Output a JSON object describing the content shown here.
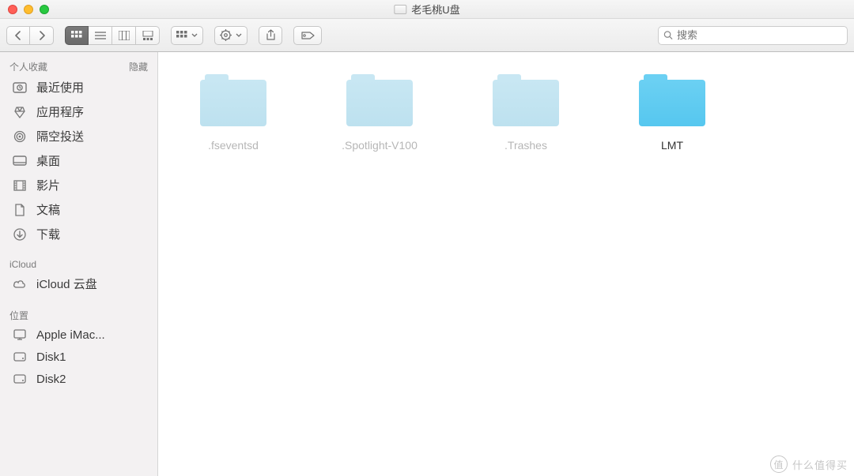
{
  "window": {
    "title": "老毛桃U盘"
  },
  "toolbar": {
    "search_placeholder": "搜索"
  },
  "sidebar": {
    "sections": [
      {
        "title": "个人收藏",
        "hide_label": "隐藏",
        "items": [
          {
            "icon": "clock",
            "label": "最近使用"
          },
          {
            "icon": "apps",
            "label": "应用程序"
          },
          {
            "icon": "airdrop",
            "label": "隔空投送"
          },
          {
            "icon": "desktop",
            "label": "桌面"
          },
          {
            "icon": "movies",
            "label": "影片"
          },
          {
            "icon": "docs",
            "label": "文稿"
          },
          {
            "icon": "downloads",
            "label": "下载"
          }
        ]
      },
      {
        "title": "iCloud",
        "hide_label": "",
        "items": [
          {
            "icon": "cloud",
            "label": "iCloud 云盘"
          }
        ]
      },
      {
        "title": "位置",
        "hide_label": "",
        "items": [
          {
            "icon": "computer",
            "label": "Apple iMac..."
          },
          {
            "icon": "hdd",
            "label": "Disk1"
          },
          {
            "icon": "hdd",
            "label": "Disk2"
          }
        ]
      }
    ]
  },
  "folders": [
    {
      "name": ".fseventsd",
      "hidden": true
    },
    {
      "name": ".Spotlight-V100",
      "hidden": true
    },
    {
      "name": ".Trashes",
      "hidden": true
    },
    {
      "name": "LMT",
      "hidden": false
    }
  ],
  "watermark": {
    "text": "什么值得买"
  }
}
